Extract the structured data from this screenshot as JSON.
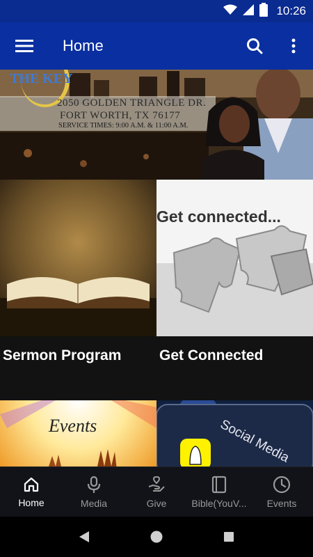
{
  "status_bar": {
    "time": "10:26"
  },
  "app_bar": {
    "title": "Home"
  },
  "banner": {
    "logo_text": "THE KEY",
    "address_line1": "2050 GOLDEN TRIANGLE DR.",
    "address_line2": "FORT WORTH, TX 76177",
    "service_times": "SERVICE TIMES: 9:00 A.M. & 11:00 A.M."
  },
  "tiles": [
    {
      "caption": "Sermon Program",
      "image": "open-bible-image"
    },
    {
      "caption": "Get Connected",
      "image": "puzzle-pieces-image",
      "image_text": "Get connected..."
    },
    {
      "caption": "",
      "image": "events-hands-image",
      "image_text": "Events"
    },
    {
      "caption": "",
      "image": "social-media-phone-image",
      "image_text": "Social Media"
    }
  ],
  "bottom_nav": {
    "items": [
      {
        "label": "Home",
        "icon": "home-icon",
        "active": true
      },
      {
        "label": "Media",
        "icon": "microphone-icon",
        "active": false
      },
      {
        "label": "Give",
        "icon": "give-heart-hand-icon",
        "active": false
      },
      {
        "label": "Bible(YouV...",
        "icon": "book-icon",
        "active": false
      },
      {
        "label": "Events",
        "icon": "clock-icon",
        "active": false
      }
    ]
  },
  "colors": {
    "app_bar": "#0a2fa0",
    "status_bar": "#0a2b8f",
    "nav_active": "#ffffff",
    "nav_inactive": "#9a9a9a"
  }
}
